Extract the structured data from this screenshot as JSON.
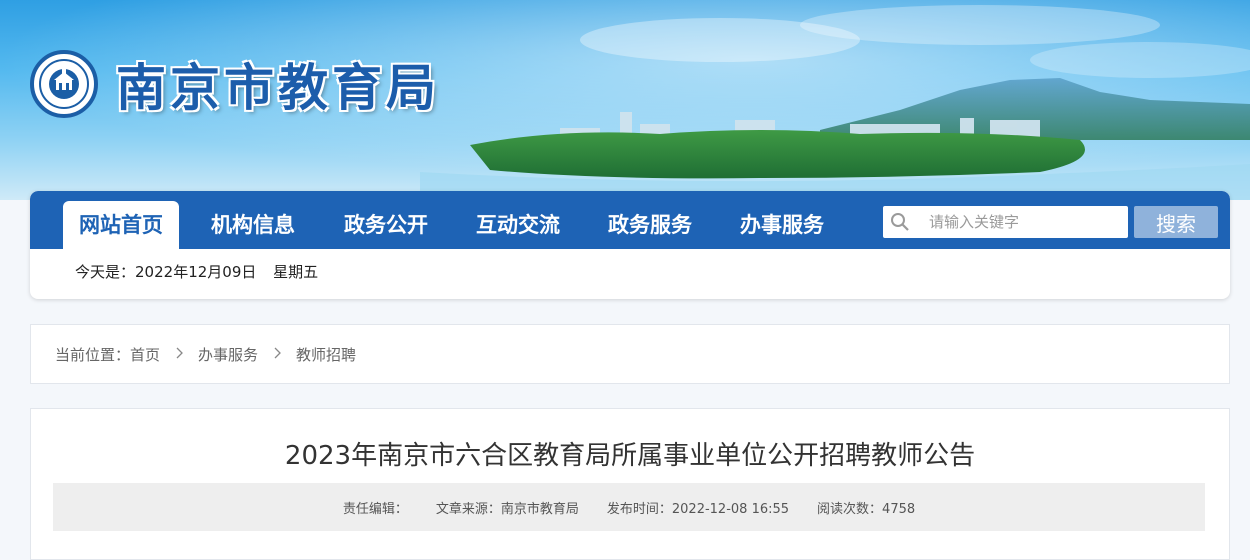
{
  "header": {
    "site_title": "南京市教育局",
    "emblem_icon": "nanjing-education-emblem-icon"
  },
  "nav": {
    "items": [
      {
        "label": "网站首页",
        "active": true
      },
      {
        "label": "机构信息",
        "active": false
      },
      {
        "label": "政务公开",
        "active": false
      },
      {
        "label": "互动交流",
        "active": false
      },
      {
        "label": "政务服务",
        "active": false
      },
      {
        "label": "办事服务",
        "active": false
      }
    ],
    "search_placeholder": "请输入关键字",
    "search_button": "搜索",
    "search_icon": "search-icon"
  },
  "today": {
    "prefix": "今天是：",
    "date": "2022年12月09日",
    "weekday": "星期五"
  },
  "breadcrumb": {
    "lead": "当前位置：",
    "items": [
      "首页",
      "办事服务",
      "教师招聘"
    ]
  },
  "article": {
    "title": "2023年南京市六合区教育局所属事业单位公开招聘教师公告",
    "editor": "责任编辑：",
    "source": "文章来源：南京市教育局",
    "publish_time": "发布时间：2022-12-08 16:55",
    "views": "阅读次数：4758"
  },
  "colors": {
    "nav_blue": "#1e63b5",
    "search_button": "#8fb2db",
    "title_blue": "#1c5dab"
  }
}
